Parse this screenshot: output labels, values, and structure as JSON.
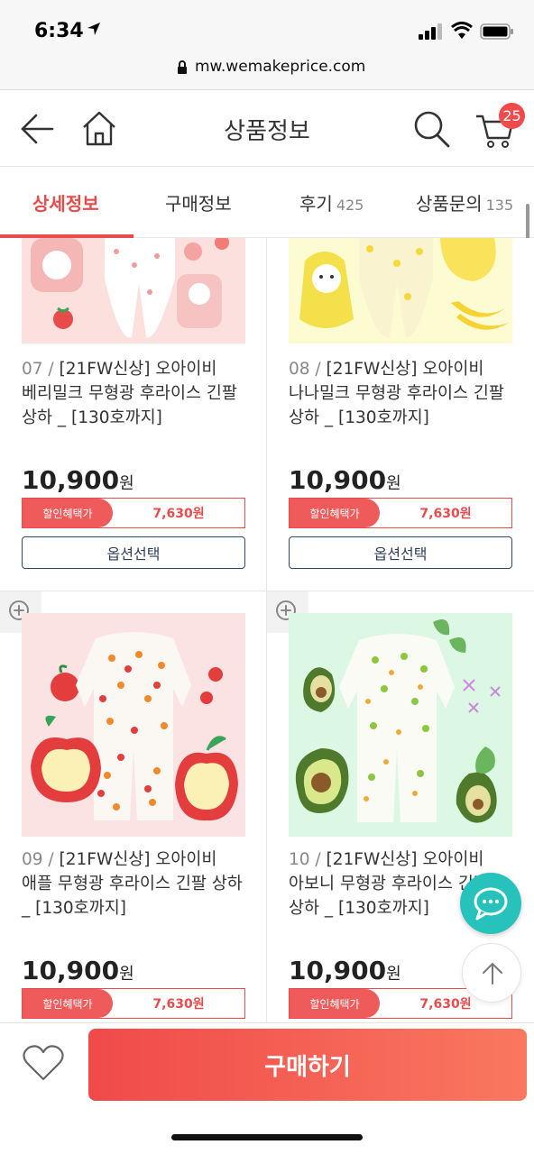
{
  "status": {
    "time": "6:34"
  },
  "browser": {
    "url": "mw.wemakeprice.com"
  },
  "header": {
    "title": "상품정보",
    "cart_count": "25"
  },
  "tabs": [
    {
      "label": "상세정보",
      "count": "",
      "active": true
    },
    {
      "label": "구매정보",
      "count": ""
    },
    {
      "label": "후기",
      "count": "425"
    },
    {
      "label": "상품문의",
      "count": "135"
    }
  ],
  "products": [
    {
      "num": "07 /",
      "name": "[21FW신상] 오아이비 베리밀크 무형광 후라이스 긴팔 상하 _ [130호까지]",
      "price": "10,900",
      "won": "원",
      "discount_label": "할인혜택가",
      "discount_price": "7,630원",
      "option_label": "옵션선택"
    },
    {
      "num": "08 /",
      "name": "[21FW신상] 오아이비 나나밀크 무형광 후라이스 긴팔 상하 _ [130호까지]",
      "price": "10,900",
      "won": "원",
      "discount_label": "할인혜택가",
      "discount_price": "7,630원",
      "option_label": "옵션선택"
    },
    {
      "num": "09 /",
      "name": "[21FW신상] 오아이비 애플 무형광 후라이스 긴팔 상하 _ [130호까지]",
      "price": "10,900",
      "won": "원",
      "discount_label": "할인혜택가",
      "discount_price": "7,630원"
    },
    {
      "num": "10 /",
      "name": "[21FW신상] 오아이비 아보니 무형광 후라이스 긴팔 상하 _ [130호까지]",
      "price": "10,900",
      "won": "원",
      "discount_label": "할인혜택가",
      "discount_price": "7,630원"
    }
  ],
  "bottom": {
    "buy_label": "구매하기"
  },
  "colors": {
    "accent": "#e94b4b",
    "chat": "#27c2bc",
    "option_border": "#2c4a6e"
  }
}
